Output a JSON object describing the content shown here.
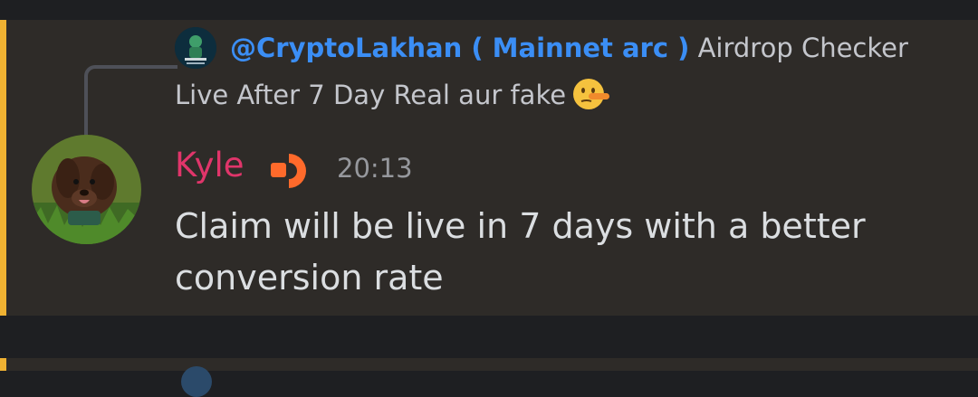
{
  "reply": {
    "author": "@CryptoLakhan ( Mainnet arc )",
    "text_line1": "Airdrop Checker",
    "text_line2": "Live After 7 Day Real aur fake"
  },
  "message": {
    "username": "Kyle",
    "timestamp": "20:13",
    "content": "Claim will be live in 7 days with a better conversion rate"
  },
  "icons": {
    "reply_emoji": "lying-face-emoji",
    "user_badge": "orange-badge-icon"
  },
  "colors": {
    "accent": "#f0b232",
    "username": "#e0356a",
    "mention": "#3b8ef5",
    "badge": "#ff6a2b"
  }
}
